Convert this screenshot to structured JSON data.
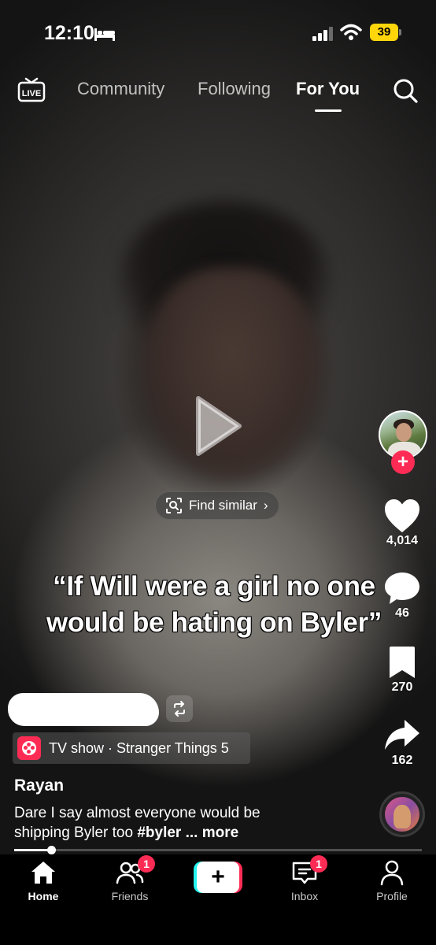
{
  "status_bar": {
    "time": "12:10",
    "battery": "39"
  },
  "top_nav": {
    "live_label": "LIVE",
    "tabs": [
      {
        "label": "Community",
        "active": false
      },
      {
        "label": "Following",
        "active": false
      },
      {
        "label": "For You",
        "active": true
      }
    ]
  },
  "video": {
    "find_similar_label": "Find similar",
    "caption": "“If Will were a girl no one\nwould be hating on Byler”",
    "progress": 0.09
  },
  "right_rail": {
    "likes": "4,014",
    "comments": "46",
    "saves": "270",
    "shares": "162",
    "follow_label": "+"
  },
  "post": {
    "anchor_text": "TV show · Stranger Things 5",
    "author": "Rayan",
    "description_line1": "Dare I say almost everyone would be",
    "description_line2_text": "shipping Byler too ",
    "hashtag": "#byler",
    "more_label": " ... more"
  },
  "bottom_nav": {
    "items": [
      {
        "label": "Home",
        "active": true
      },
      {
        "label": "Friends",
        "badge": "1"
      },
      {
        "label": "Inbox",
        "badge": "1"
      },
      {
        "label": "Profile"
      }
    ],
    "create_label": "+"
  },
  "colors": {
    "accent": "#fe2c55",
    "cyan": "#25f4ee",
    "battery": "#ffd60a"
  }
}
